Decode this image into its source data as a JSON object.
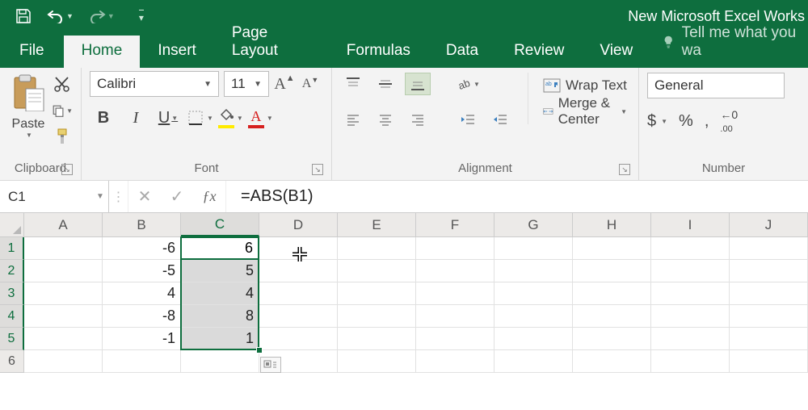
{
  "titlebar": {
    "doc_title": "New Microsoft Excel Works"
  },
  "tabs": {
    "file": "File",
    "home": "Home",
    "insert": "Insert",
    "page_layout": "Page Layout",
    "formulas": "Formulas",
    "data": "Data",
    "review": "Review",
    "view": "View",
    "tellme": "Tell me what you wa"
  },
  "ribbon": {
    "clipboard": {
      "label": "Clipboard",
      "paste": "Paste"
    },
    "font": {
      "label": "Font",
      "name": "Calibri",
      "size": "11",
      "bold": "B",
      "italic": "I",
      "underline": "U"
    },
    "alignment": {
      "label": "Alignment",
      "wrap": "Wrap Text",
      "merge": "Merge & Center"
    },
    "number": {
      "label": "Number",
      "format": "General",
      "currency": "$",
      "percent": "%",
      "comma": ",",
      "decimals": ".00"
    }
  },
  "formula_bar": {
    "name_box": "C1",
    "formula": "=ABS(B1)"
  },
  "grid": {
    "columns": [
      "A",
      "B",
      "C",
      "D",
      "E",
      "F",
      "G",
      "H",
      "I",
      "J"
    ],
    "rows": [
      {
        "n": "1",
        "B": "-6",
        "C": "6"
      },
      {
        "n": "2",
        "B": "-5",
        "C": "5"
      },
      {
        "n": "3",
        "B": "4",
        "C": "4"
      },
      {
        "n": "4",
        "B": "-8",
        "C": "8"
      },
      {
        "n": "5",
        "B": "-1",
        "C": "1"
      },
      {
        "n": "6"
      }
    ],
    "selection": {
      "range": "C1:C5",
      "active": "C1"
    }
  }
}
